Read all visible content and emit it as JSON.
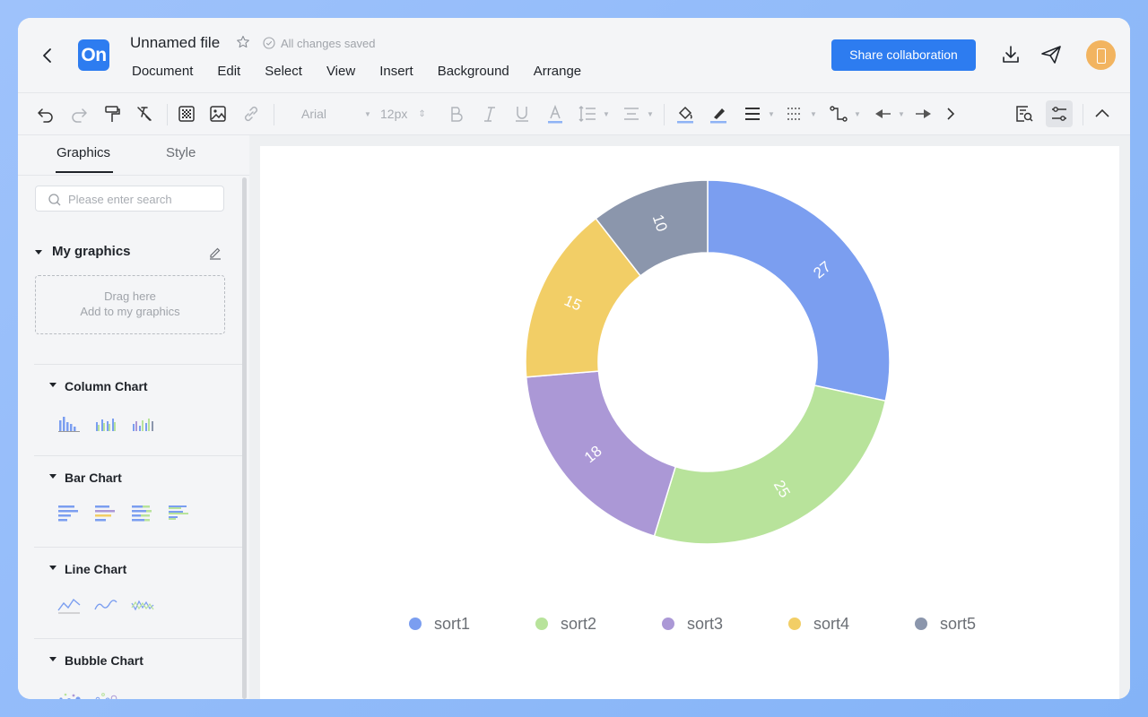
{
  "header": {
    "file_title": "Unnamed file",
    "save_status": "All changes saved",
    "app_logo": "On",
    "share_label": "Share collaboration",
    "menu": [
      "Document",
      "Edit",
      "Select",
      "View",
      "Insert",
      "Background",
      "Arrange"
    ]
  },
  "toolbar": {
    "font_family": "Arial",
    "font_size": "12px"
  },
  "sidebar": {
    "tabs": {
      "graphics": "Graphics",
      "style": "Style"
    },
    "search_placeholder": "Please enter search",
    "my_graphics": {
      "title": "My graphics",
      "drop_line1": "Drag here",
      "drop_line2": "Add to my graphics"
    },
    "categories": [
      {
        "title": "Column Chart"
      },
      {
        "title": "Bar Chart"
      },
      {
        "title": "Line Chart"
      },
      {
        "title": "Bubble Chart"
      }
    ]
  },
  "colors": {
    "accent": "#2d7cf0",
    "series": [
      "#7b9ef0",
      "#b8e39b",
      "#ab98d6",
      "#f2ce66",
      "#8b96ac"
    ]
  },
  "chart_data": {
    "type": "pie",
    "donut": true,
    "categories": [
      "sort1",
      "sort2",
      "sort3",
      "sort4",
      "sort5"
    ],
    "values": [
      27,
      25,
      18,
      15,
      10
    ],
    "data_labels": [
      "27",
      "25",
      "18",
      "15",
      "10"
    ],
    "legend_position": "bottom",
    "title": ""
  }
}
